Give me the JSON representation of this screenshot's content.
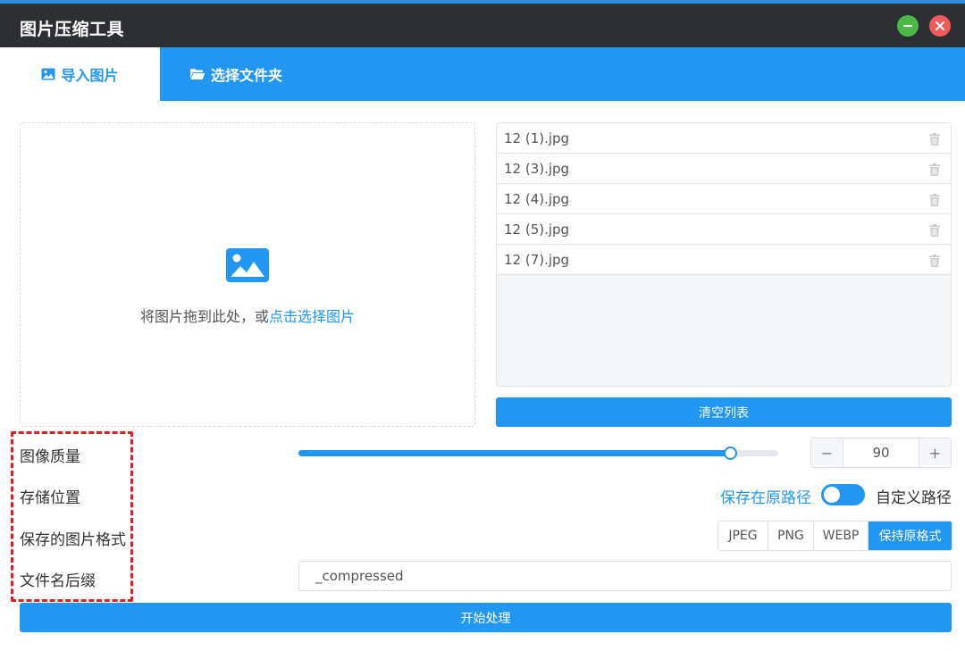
{
  "window": {
    "title": "图片压缩工具",
    "controls": [
      "minimize-icon",
      "close-icon"
    ]
  },
  "tabs": [
    {
      "label": "导入图片",
      "icon": "image-icon",
      "active": true
    },
    {
      "label": "选择文件夹",
      "icon": "folder-open-icon",
      "active": false
    }
  ],
  "dropzone": {
    "icon": "image-icon",
    "text": "将图片拖到此处，或",
    "link": "点击选择图片"
  },
  "files": [
    {
      "name": "12 (1).jpg"
    },
    {
      "name": "12 (3).jpg"
    },
    {
      "name": "12 (4).jpg"
    },
    {
      "name": "12 (5).jpg"
    },
    {
      "name": "12 (7).jpg"
    }
  ],
  "clear_button": "清空列表",
  "settings": {
    "quality_label": "图像质量",
    "quality_value": "90",
    "quality_fraction": 0.9,
    "stepper_minus": "−",
    "stepper_plus": "+",
    "location_label": "存储位置",
    "location_active": "保存在原路径",
    "location_other": "自定义路径",
    "format_label": "保存的图片格式",
    "formats": [
      "JPEG",
      "PNG",
      "WEBP",
      "保持原格式"
    ],
    "selected_format": "保持原格式",
    "suffix_label": "文件名后缀",
    "suffix_value": "_compressed"
  },
  "start_button": "开始处理",
  "colors": {
    "accent": "#2196f3",
    "titlebar": "#2e2f33",
    "highlight": "#e02020"
  }
}
